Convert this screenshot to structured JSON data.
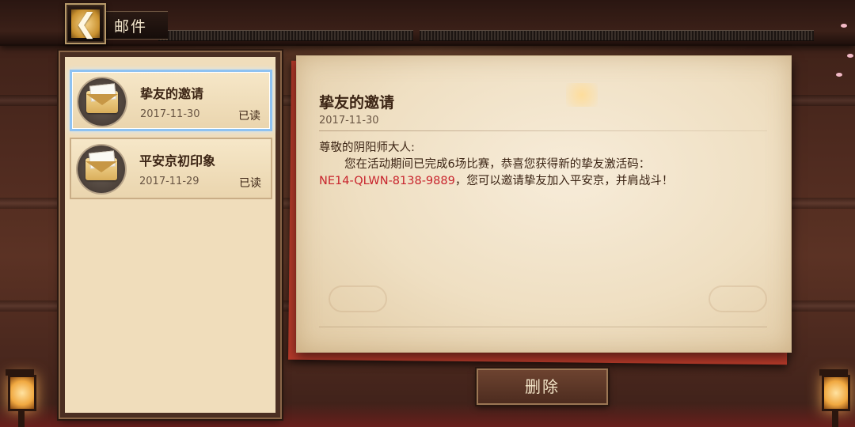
{
  "header": {
    "title": "邮件",
    "back_icon": "back-arrow-icon"
  },
  "mail_list": {
    "items": [
      {
        "title": "挚友的邀请",
        "date": "2017-11-30",
        "status": "已读",
        "icon": "envelope-icon",
        "selected": true
      },
      {
        "title": "平安京初印象",
        "date": "2017-11-29",
        "status": "已读",
        "icon": "envelope-icon",
        "selected": false
      }
    ]
  },
  "letter": {
    "title": "挚友的邀请",
    "date": "2017-11-30",
    "greeting": "尊敬的阴阳师大人:",
    "line1": "您在活动期间已完成6场比赛，恭喜您获得新的挚友激活码：",
    "invite_code": "NE14-QLWN-8138-9889",
    "line2": "，您可以邀请挚友加入平安京，并肩战斗！"
  },
  "actions": {
    "delete_label": "删除"
  },
  "colors": {
    "selected_border": "#8ec2f2",
    "invite_code": "#c8232c",
    "paper": "#f2e4cb",
    "wood": "#4a2e22"
  }
}
